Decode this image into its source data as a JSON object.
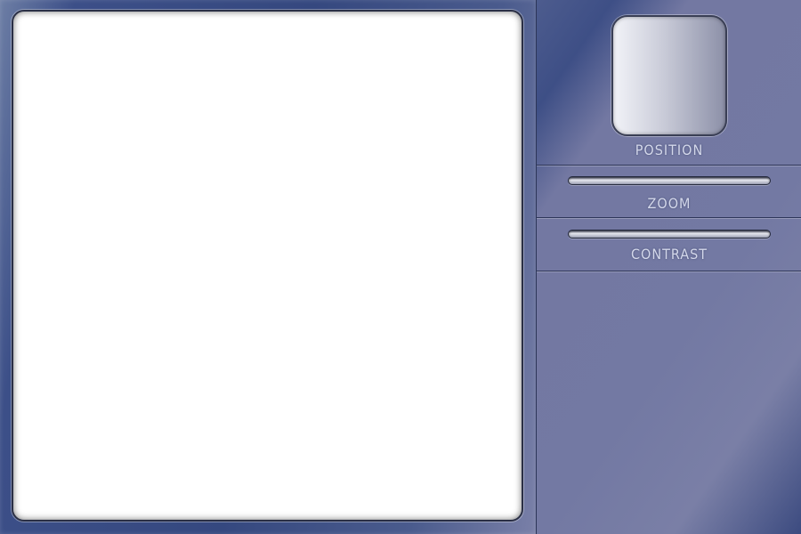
{
  "controls": {
    "position_label": "POSITION",
    "zoom_label": "ZOOM",
    "contrast_label": "CONTRAST"
  },
  "colors": {
    "frame": "#3c4f88",
    "panel": "#7379a3",
    "label_text": "#d4d8ea",
    "canvas": "#ffffff"
  }
}
